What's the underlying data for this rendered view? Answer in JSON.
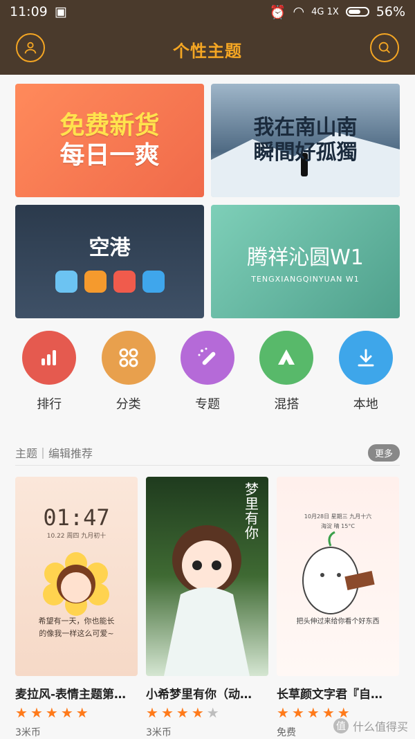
{
  "statusbar": {
    "time": "11:09",
    "network": "4G 1X",
    "battery": "56%"
  },
  "header": {
    "title": "个性主题",
    "profile_icon": "person-icon",
    "search_icon": "search-icon"
  },
  "banners": [
    {
      "line1": "免费新货",
      "line2": "每日一爽",
      "bg": "#f06a4a"
    },
    {
      "line1": "我在南山南",
      "line2": "瞬間好孤獨",
      "bg": "#4f6a83"
    },
    {
      "title": "空港",
      "bg": "#2b3a4c"
    },
    {
      "title": "腾祥沁圆W1",
      "subtitle": "TENGXIANGQINYUAN W1",
      "bg": "#4fa08c"
    }
  ],
  "categories": [
    {
      "label": "排行",
      "color": "#e55a4f",
      "icon": "ranking-icon"
    },
    {
      "label": "分类",
      "color": "#e8a04d",
      "icon": "category-icon"
    },
    {
      "label": "专题",
      "color": "#b56ad8",
      "icon": "magic-wand-icon"
    },
    {
      "label": "混搭",
      "color": "#58b96a",
      "icon": "triangle-icon"
    },
    {
      "label": "本地",
      "color": "#3ea6ea",
      "icon": "download-icon"
    }
  ],
  "section": {
    "title": "主题｜编辑推荐",
    "more": "更多"
  },
  "cards": [
    {
      "name": "麦拉风-表情主题第…",
      "rating": 4.5,
      "price": "3米币",
      "thumb": {
        "clock": "01:47",
        "date": "10.22 周四 九月初十",
        "caption1": "希望有一天，你也能长",
        "caption2": "的像我一样这么可爱~"
      }
    },
    {
      "name": "小希梦里有你（动…",
      "rating": 4,
      "price": "3米币",
      "thumb": {
        "vertical_text": "梦里有你"
      }
    },
    {
      "name": "长草颜文字君『自…",
      "rating": 4.5,
      "price": "免费",
      "thumb": {
        "date": "10月28日 星期三 九月十六",
        "place": "海淀 晴 15°C",
        "caption": "把头伸过来给你看个好东西"
      }
    }
  ],
  "watermark": {
    "text": "什么值得买",
    "badge": "值"
  }
}
